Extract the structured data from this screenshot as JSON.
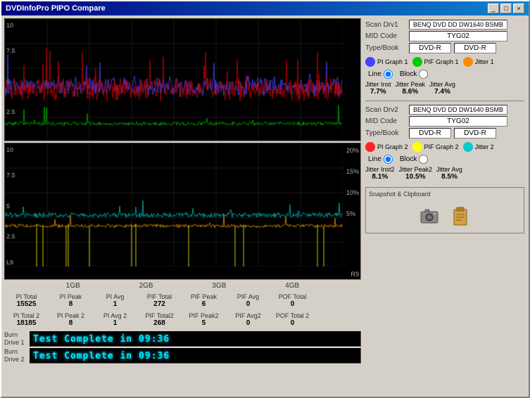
{
  "window": {
    "title": "DVDInfoPro PIPO Compare",
    "controls": [
      "_",
      "□",
      "×"
    ]
  },
  "scan1": {
    "drv_label": "Scan Drv1",
    "drv_value": "BENQ   DVD DD DW1640 BSMB",
    "mid_label": "MID Code",
    "mid_value": "TYG02",
    "type_label": "Type/Book",
    "type_value1": "DVD-R",
    "type_value2": "DVD-R",
    "pi_graph_label": "PI Graph 1",
    "pif_graph_label": "PIF Graph 1",
    "jitter_label": "Jitter 1",
    "line_label": "Line",
    "block_label": "Block",
    "jitter_inst_label": "Jitter Inst",
    "jitter_inst_val": "7.7%",
    "jitter_peak_label": "Jitter Peak",
    "jitter_peak_val": "8.6%",
    "jitter_avg_label": "Jitter Avg",
    "jitter_avg_val": "7.4%"
  },
  "scan2": {
    "drv_label": "Scan Drv2",
    "drv_value": "BENQ   DVD DD DW1640 BSMB",
    "mid_label": "MID Code",
    "mid_value": "TYG02",
    "type_label": "Type/Book",
    "type_value1": "DVD-R",
    "type_value2": "DVD-R",
    "pi_graph_label": "PI Graph 2",
    "pif_graph_label": "PIF Graph 2",
    "jitter_label": "Jitter 2",
    "line_label": "Line",
    "block_label": "Block",
    "jitter_inst_label": "Jitter Inst2",
    "jitter_inst_val": "8.1%",
    "jitter_peak_label": "Jitter Peak2",
    "jitter_peak_val": "10.5%",
    "jitter_avg_label": "Jitter Avg",
    "jitter_avg_val": "8.5%"
  },
  "stats1": {
    "pi_total_label": "PI Total",
    "pi_total_val": "15525",
    "pi_peak_label": "PI Peak",
    "pi_peak_val": "8",
    "pi_avg_label": "PI Avg",
    "pi_avg_val": "1",
    "pif_total_label": "PIF Total",
    "pif_total_val": "272",
    "pif_peak_label": "PIF Peak",
    "pif_peak_val": "6",
    "pif_avg_label": "PIF Avg",
    "pif_avg_val": "0",
    "pof_total_label": "POF Total",
    "pof_total_val": "0"
  },
  "stats2": {
    "pi_total_label": "PI Total 2",
    "pi_total_val": "18185",
    "pi_peak_label": "PI Peak 2",
    "pi_peak_val": "8",
    "pi_avg_label": "PI Avg 2",
    "pi_avg_val": "1",
    "pif_total_label": "PIF Total2",
    "pif_total_val": "268",
    "pif_peak_label": "PIF Peak2",
    "pif_peak_val": "5",
    "pif_avg_label": "PIF Avg2",
    "pif_avg_val": "0",
    "pof_total_label": "POF Total 2",
    "pof_total_val": "0"
  },
  "x_axis": {
    "labels": [
      "1GB",
      "2GB",
      "3GB",
      "4GB"
    ]
  },
  "burn": {
    "drive1_label": "Burn\nDrive 1",
    "drive1_text": "Test Complete in 09:36",
    "drive2_label": "Burn\nDrive 2",
    "drive2_text": "Test Complete in 09:36"
  },
  "snapshot": {
    "title": "Snapshot & Clipboard",
    "camera_icon": "📷",
    "clipboard_icon": "📋"
  },
  "colors": {
    "pi_graph1": "#4444ff",
    "pif_graph1": "#00cc00",
    "jitter1": "#ff8800",
    "pi_graph2": "#ff2222",
    "pif_graph2": "#ffff00",
    "jitter2": "#00cccc"
  }
}
